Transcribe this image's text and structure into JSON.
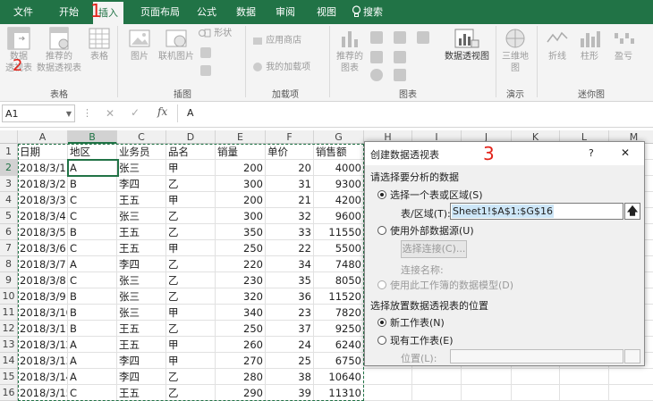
{
  "tabs": [
    "文件",
    "开始",
    "插入",
    "页面布局",
    "公式",
    "数据",
    "审阅",
    "视图",
    "搜索"
  ],
  "annotations": [
    "1",
    "2",
    "3"
  ],
  "ribbon": {
    "pivot_label": "数据\n透视表",
    "recommended_pivot_label": "推荐的\n数据透视表",
    "table_label": "表格",
    "picture_label": "图片",
    "online_picture_label": "联机图片",
    "shapes_label": "形状",
    "app_store_label": "应用商店",
    "my_addins_label": "我的加载项",
    "recommended_charts_label": "推荐的\n图表",
    "pivot_chart_label": "数据透视图",
    "map_3d_label": "三维地\n图",
    "line_label": "折线",
    "column_label": "柱形",
    "winloss_label": "盈亏",
    "groups": [
      "表格",
      "插图",
      "加载项",
      "图表",
      "演示",
      "迷你图"
    ]
  },
  "formula_bar": {
    "name_box": "A1",
    "value": "A"
  },
  "columns": [
    "A",
    "B",
    "C",
    "D",
    "E",
    "F",
    "G",
    "H",
    "I",
    "J",
    "K",
    "L",
    "M"
  ],
  "rows": [
    [
      "日期",
      "地区",
      "业务员",
      "品名",
      "销量",
      "单价",
      "销售额"
    ],
    [
      "2018/3/1",
      "A",
      "张三",
      "甲",
      "200",
      "20",
      "4000"
    ],
    [
      "2018/3/2",
      "B",
      "李四",
      "乙",
      "300",
      "31",
      "9300"
    ],
    [
      "2018/3/3",
      "C",
      "王五",
      "甲",
      "200",
      "21",
      "4200"
    ],
    [
      "2018/3/4",
      "C",
      "张三",
      "乙",
      "300",
      "32",
      "9600"
    ],
    [
      "2018/3/5",
      "B",
      "王五",
      "乙",
      "350",
      "33",
      "11550"
    ],
    [
      "2018/3/6",
      "C",
      "王五",
      "甲",
      "250",
      "22",
      "5500"
    ],
    [
      "2018/3/7",
      "A",
      "李四",
      "乙",
      "220",
      "34",
      "7480"
    ],
    [
      "2018/3/8",
      "C",
      "张三",
      "乙",
      "230",
      "35",
      "8050"
    ],
    [
      "2018/3/9",
      "B",
      "张三",
      "乙",
      "320",
      "36",
      "11520"
    ],
    [
      "2018/3/10",
      "B",
      "张三",
      "甲",
      "340",
      "23",
      "7820"
    ],
    [
      "2018/3/11",
      "B",
      "王五",
      "乙",
      "250",
      "37",
      "9250"
    ],
    [
      "2018/3/12",
      "A",
      "王五",
      "甲",
      "260",
      "24",
      "6240"
    ],
    [
      "2018/3/13",
      "A",
      "李四",
      "甲",
      "270",
      "25",
      "6750"
    ],
    [
      "2018/3/14",
      "A",
      "李四",
      "乙",
      "280",
      "38",
      "10640"
    ],
    [
      "2018/3/15",
      "C",
      "王五",
      "乙",
      "290",
      "39",
      "11310"
    ]
  ],
  "dialog": {
    "title": "创建数据透视表",
    "help": "?",
    "close": "✕",
    "section1": "请选择要分析的数据",
    "opt_range": "选择一个表或区域(S)",
    "range_label": "表/区域(T):",
    "range_value": "Sheet1!$A$1:$G$16",
    "opt_external": "使用外部数据源(U)",
    "choose_conn": "选择连接(C)...",
    "conn_name": "连接名称:",
    "opt_model": "使用此工作簿的数据模型(D)",
    "section2": "选择放置数据透视表的位置",
    "opt_new": "新工作表(N)",
    "opt_existing": "现有工作表(E)",
    "location_label": "位置(L):"
  }
}
